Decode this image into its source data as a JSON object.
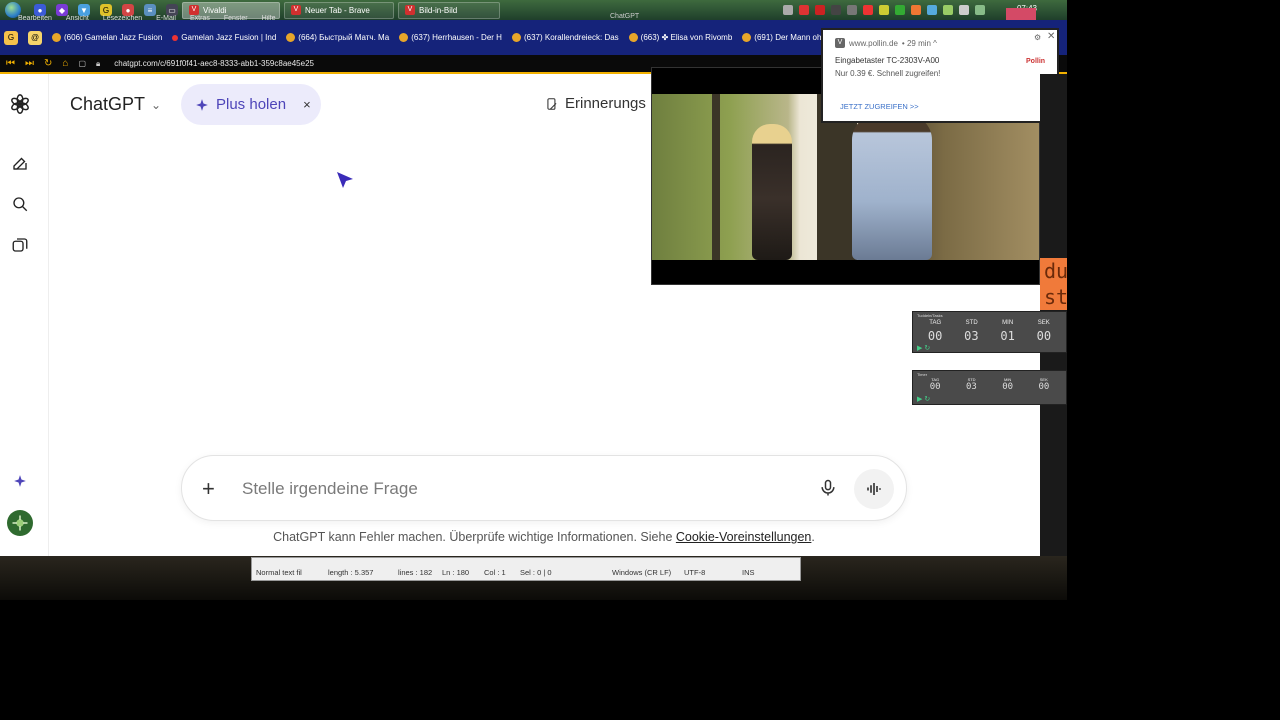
{
  "taskbar": {
    "menu": [
      "Bearbeiten",
      "Ansicht",
      "Lesezeichen",
      "E-Mail",
      "Extras",
      "Fenster",
      "Hilfe"
    ],
    "tasks": [
      {
        "label": "Vivaldi",
        "active": true
      },
      {
        "label": "Neuer Tab - Brave",
        "active": false
      },
      {
        "label": "Bild-in-Bild",
        "active": false
      }
    ],
    "window_caption": "ChatGPT",
    "clock": "07:43"
  },
  "bookmarks": [
    {
      "label": "(606) Gamelan Jazz Fusion"
    },
    {
      "label": "Gamelan Jazz Fusion | Ind"
    },
    {
      "label": "(664) Быстрый Матч. Ма"
    },
    {
      "label": "(637) Herrhausen - Der H"
    },
    {
      "label": "(637) Korallendreieck: Das"
    },
    {
      "label": "(663) ✤ Elisa von Rivomb"
    },
    {
      "label": "(691) Der Mann oh"
    }
  ],
  "address": {
    "url": "chatgpt.com/c/691f0f41-aec8-8333-abb1-359c8ae45e25"
  },
  "chatgpt": {
    "model": "ChatGPT",
    "plus_label": "Plus holen",
    "plus_close": "×",
    "memory_label": "Erinnerungs",
    "input_placeholder": "Stelle irgendeine Frage",
    "disclaimer_text": "ChatGPT kann Fehler machen. Überprüfe wichtige Informationen. Siehe ",
    "disclaimer_link": "Cookie-Voreinstellungen",
    "disclaimer_end": "."
  },
  "notification": {
    "source": "www.pollin.de",
    "age": "• 29 min ^",
    "title": "Eingabetaster TC-2303V-A00",
    "body": "Nur 0.39 €. Schnell zugreifen!",
    "action": "JETZT ZUGREIFEN >>",
    "logo": "Pollin",
    "gear": "⚙",
    "close": "✕"
  },
  "countdown1": {
    "title": "Tuddeln/Tasks",
    "labels": [
      "TAG",
      "STD",
      "MIN",
      "SEK"
    ],
    "values": [
      "00",
      "03",
      "01",
      "00"
    ]
  },
  "countdown2": {
    "title": "Timer",
    "labels": [
      "TAG",
      "STD",
      "MIN",
      "SEK"
    ],
    "values": [
      "00",
      "03",
      "00",
      "00"
    ]
  },
  "side_panel_text": "du st",
  "editor_status": {
    "normal": "Normal text fil",
    "length": "length : 5.357",
    "lines": "lines : 182",
    "ln": "Ln : 180",
    "col": "Col : 1",
    "sel": "Sel : 0 | 0",
    "eol": "Windows (CR LF)",
    "enc": "UTF-8",
    "mode": "INS"
  },
  "colors": {
    "accent_plus": "#4e45b9",
    "address_border": "#f2b100",
    "bookmark_bg": "#15237a"
  }
}
